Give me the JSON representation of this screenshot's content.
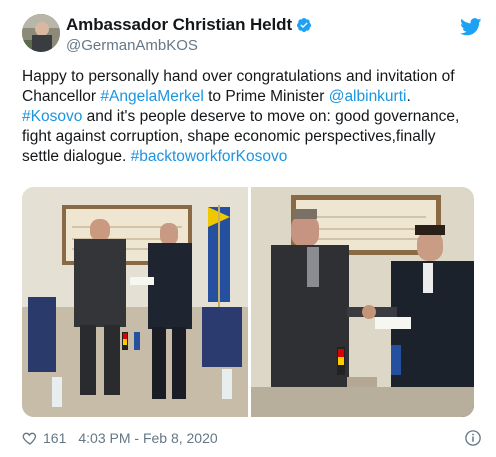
{
  "author": {
    "name": "Ambassador Christian Heldt",
    "handle": "@GermanAmbKOS",
    "avatar_icon": "avatar",
    "verified_icon": "verified-badge-icon"
  },
  "brand": {
    "icon": "twitter-bird-icon",
    "color": "#1da1f2"
  },
  "tweet": {
    "line1": "Happy to personally hand over congratulations and invitation of",
    "line2_pre": "Chancellor ",
    "line2_link1": "#AngelaMerkel",
    "line2_mid": " to Prime Minister ",
    "line2_link2": "@albinkurti",
    "line2_post": ".",
    "line3_link": "#Kosovo",
    "line3_post": " and it's people deserve to move on: good governance,",
    "line4": "fight against corruption, shape economic perspectives,finally",
    "line5_pre": "settle dialogue. ",
    "line5_link": "#backtoworkforKosovo",
    "link_color": "#1b95e0"
  },
  "media": {
    "photo_left": "handover-photo-left",
    "photo_right": "handshake-photo-right"
  },
  "footer": {
    "like_icon": "heart-icon",
    "likes": "161",
    "timestamp": "4:03 PM - Feb 8, 2020",
    "info_icon": "info-icon"
  }
}
